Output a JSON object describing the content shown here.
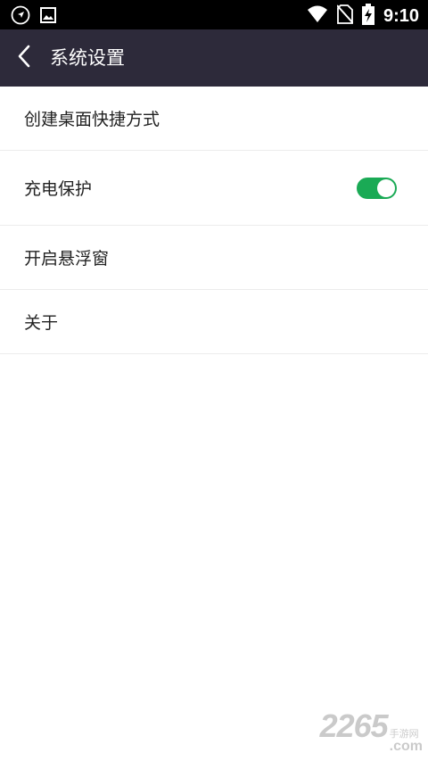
{
  "status_bar": {
    "time": "9:10",
    "icons": [
      "navigation-icon",
      "image-icon",
      "wifi-icon",
      "no-sim-icon",
      "battery-charging-icon"
    ]
  },
  "app_bar": {
    "title": "系统设置",
    "back_icon": "chevron-left-icon"
  },
  "settings": {
    "items": [
      {
        "label": "创建桌面快捷方式"
      },
      {
        "label": "充电保护",
        "toggle_on": true
      },
      {
        "label": "开启悬浮窗"
      },
      {
        "label": "关于"
      }
    ]
  },
  "watermark": {
    "number": "2265",
    "cn": "手游网",
    "domain": ".com"
  },
  "colors": {
    "status_bar": "#000000",
    "app_bar": "#2d2a3a",
    "toggle_on": "#1aaa55",
    "divider": "#ececec"
  }
}
